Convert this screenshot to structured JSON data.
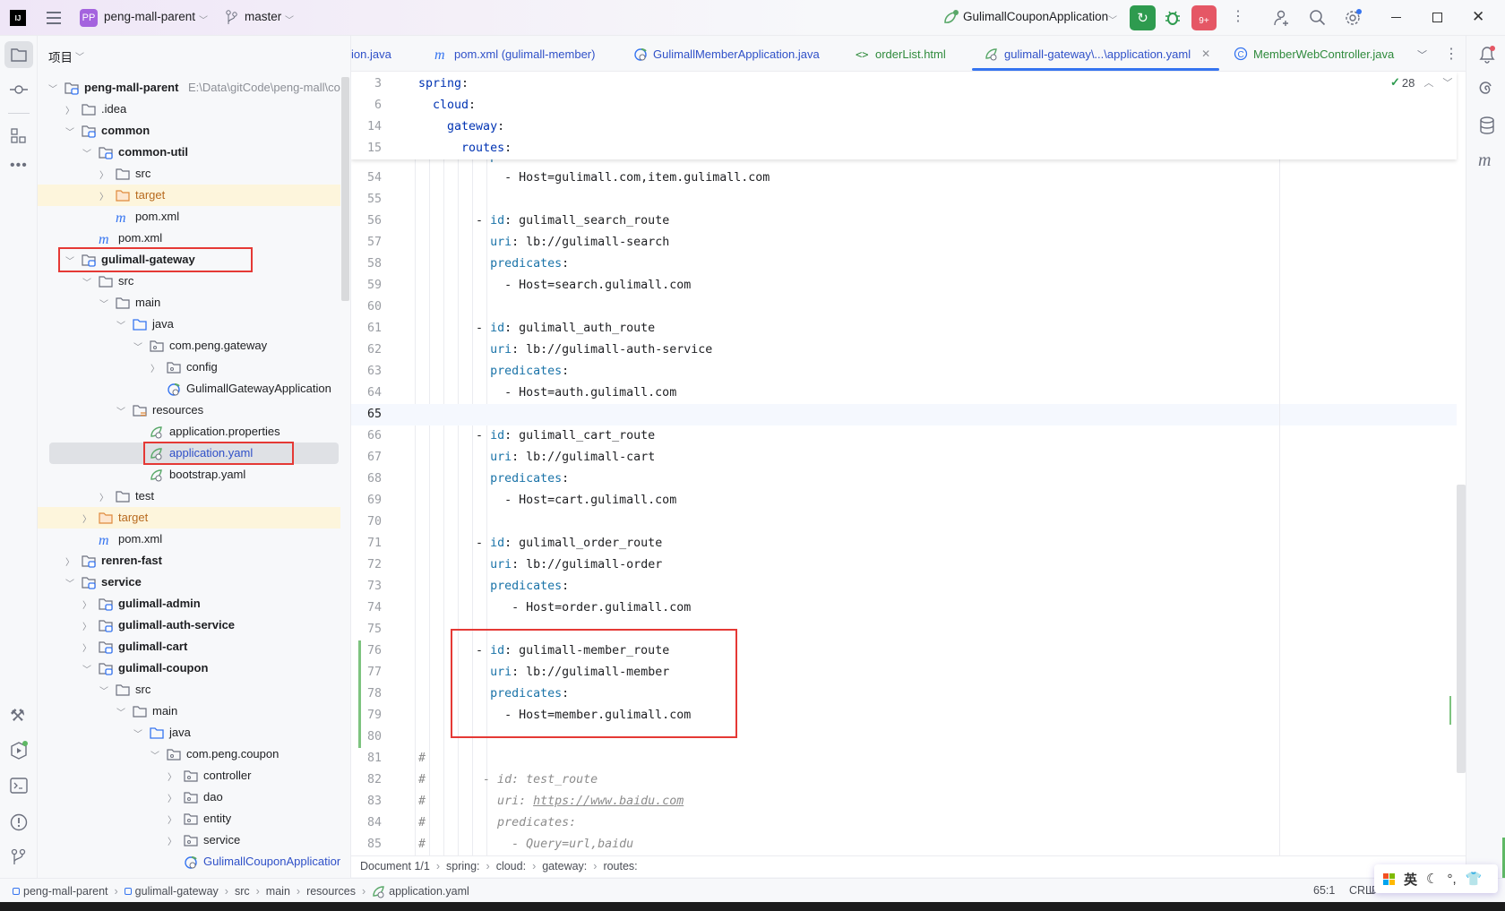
{
  "titlebar": {
    "project_badge": "PP",
    "project_name": "peng-mall-parent",
    "branch": "master",
    "run_config": "GulimallCouponApplication",
    "run_badge_count": "9+"
  },
  "project_panel": {
    "title": "项目",
    "root_path": "E:\\Data\\gitCode\\peng-mall\\cod",
    "tree": [
      {
        "label": "peng-mall-parent",
        "level": 0,
        "icon": "module",
        "expanded": true,
        "bold": true
      },
      {
        "label": ".idea",
        "level": 1,
        "icon": "folder",
        "expanded": false
      },
      {
        "label": "common",
        "level": 1,
        "icon": "module",
        "expanded": true,
        "bold": true
      },
      {
        "label": "common-util",
        "level": 2,
        "icon": "module",
        "expanded": true,
        "bold": true
      },
      {
        "label": "src",
        "level": 3,
        "icon": "folder",
        "expanded": false
      },
      {
        "label": "target",
        "level": 3,
        "icon": "excluded",
        "expanded": false,
        "highlight": true
      },
      {
        "label": "pom.xml",
        "level": 3,
        "icon": "maven"
      },
      {
        "label": "pom.xml",
        "level": 2,
        "icon": "maven"
      },
      {
        "label": "gulimall-gateway",
        "level": 1,
        "icon": "module",
        "expanded": true,
        "bold": true,
        "boxed": true
      },
      {
        "label": "src",
        "level": 2,
        "icon": "folder",
        "expanded": true
      },
      {
        "label": "main",
        "level": 3,
        "icon": "folder",
        "expanded": true
      },
      {
        "label": "java",
        "level": 4,
        "icon": "source",
        "expanded": true
      },
      {
        "label": "com.peng.gateway",
        "level": 5,
        "icon": "package",
        "expanded": true
      },
      {
        "label": "config",
        "level": 6,
        "icon": "package",
        "expanded": false
      },
      {
        "label": "GulimallGatewayApplication",
        "level": 6,
        "icon": "spring-app"
      },
      {
        "label": "resources",
        "level": 4,
        "icon": "resources",
        "expanded": true
      },
      {
        "label": "application.properties",
        "level": 5,
        "icon": "spring"
      },
      {
        "label": "application.yaml",
        "level": 5,
        "icon": "spring",
        "selected": true,
        "boxed": true
      },
      {
        "label": "bootstrap.yaml",
        "level": 5,
        "icon": "spring"
      },
      {
        "label": "test",
        "level": 3,
        "icon": "folder",
        "expanded": false
      },
      {
        "label": "target",
        "level": 2,
        "icon": "excluded",
        "expanded": false,
        "highlight": true
      },
      {
        "label": "pom.xml",
        "level": 2,
        "icon": "maven"
      },
      {
        "label": "renren-fast",
        "level": 1,
        "icon": "module",
        "expanded": false,
        "bold": true
      },
      {
        "label": "service",
        "level": 1,
        "icon": "module",
        "expanded": true,
        "bold": true
      },
      {
        "label": "gulimall-admin",
        "level": 2,
        "icon": "module",
        "expanded": false,
        "bold": true
      },
      {
        "label": "gulimall-auth-service",
        "level": 2,
        "icon": "module",
        "expanded": false,
        "bold": true
      },
      {
        "label": "gulimall-cart",
        "level": 2,
        "icon": "module",
        "expanded": false,
        "bold": true
      },
      {
        "label": "gulimall-coupon",
        "level": 2,
        "icon": "module",
        "expanded": true,
        "bold": true
      },
      {
        "label": "src",
        "level": 3,
        "icon": "folder",
        "expanded": true
      },
      {
        "label": "main",
        "level": 4,
        "icon": "folder",
        "expanded": true
      },
      {
        "label": "java",
        "level": 5,
        "icon": "source",
        "expanded": true
      },
      {
        "label": "com.peng.coupon",
        "level": 6,
        "icon": "package",
        "expanded": true
      },
      {
        "label": "controller",
        "level": 7,
        "icon": "package",
        "expanded": false
      },
      {
        "label": "dao",
        "level": 7,
        "icon": "package",
        "expanded": false
      },
      {
        "label": "entity",
        "level": 7,
        "icon": "package",
        "expanded": false
      },
      {
        "label": "service",
        "level": 7,
        "icon": "package",
        "expanded": false
      },
      {
        "label": "GulimallCouponApplication",
        "level": 7,
        "icon": "spring-app",
        "running": true
      }
    ]
  },
  "tabs": [
    {
      "label": "ion.java",
      "icon": "none",
      "color": "#2f50c8"
    },
    {
      "label": "pom.xml (gulimall-member)",
      "icon": "maven",
      "color": "#2f50c8"
    },
    {
      "label": "GulimallMemberApplication.java",
      "icon": "spring-app",
      "color": "#2f50c8"
    },
    {
      "label": "orderList.html",
      "icon": "html",
      "color": "#2f8a3c"
    },
    {
      "label": "gulimall-gateway\\...\\application.yaml",
      "icon": "spring",
      "color": "#2f50c8",
      "active": true
    },
    {
      "label": "MemberWebController.java",
      "icon": "class",
      "color": "#2f8a3c"
    }
  ],
  "editor": {
    "inspection_count": "28",
    "current_line": 65,
    "sticky_lines": [
      {
        "n": "3",
        "text": "spring:"
      },
      {
        "n": "6",
        "text": "  cloud:"
      },
      {
        "n": "14",
        "text": "    gateway:"
      },
      {
        "n": "15",
        "text": "      routes:"
      }
    ],
    "lines": [
      {
        "n": "54",
        "text": "            - Host=gulimall.com,item.gulimall.com"
      },
      {
        "n": "55",
        "text": ""
      },
      {
        "n": "56",
        "text": "        - id: gulimall_search_route"
      },
      {
        "n": "57",
        "text": "          uri: lb://gulimall-search"
      },
      {
        "n": "58",
        "text": "          predicates:"
      },
      {
        "n": "59",
        "text": "            - Host=search.gulimall.com"
      },
      {
        "n": "60",
        "text": ""
      },
      {
        "n": "61",
        "text": "        - id: gulimall_auth_route"
      },
      {
        "n": "62",
        "text": "          uri: lb://gulimall-auth-service"
      },
      {
        "n": "63",
        "text": "          predicates:"
      },
      {
        "n": "64",
        "text": "            - Host=auth.gulimall.com"
      },
      {
        "n": "65",
        "text": ""
      },
      {
        "n": "66",
        "text": "        - id: gulimall_cart_route"
      },
      {
        "n": "67",
        "text": "          uri: lb://gulimall-cart"
      },
      {
        "n": "68",
        "text": "          predicates:"
      },
      {
        "n": "69",
        "text": "            - Host=cart.gulimall.com"
      },
      {
        "n": "70",
        "text": ""
      },
      {
        "n": "71",
        "text": "        - id: gulimall_order_route"
      },
      {
        "n": "72",
        "text": "          uri: lb://gulimall-order"
      },
      {
        "n": "73",
        "text": "          predicates:"
      },
      {
        "n": "74",
        "text": "             - Host=order.gulimall.com"
      },
      {
        "n": "75",
        "text": ""
      },
      {
        "n": "76",
        "text": "        - id: gulimall-member_route",
        "changed": true
      },
      {
        "n": "77",
        "text": "          uri: lb://gulimall-member",
        "changed": true
      },
      {
        "n": "78",
        "text": "          predicates:",
        "changed": true
      },
      {
        "n": "79",
        "text": "            - Host=member.gulimall.com",
        "changed": true
      },
      {
        "n": "80",
        "text": "",
        "changed": true
      },
      {
        "n": "81",
        "text": "#"
      },
      {
        "n": "82",
        "text": "#        - id: test_route"
      },
      {
        "n": "83",
        "text": "#          uri: https://www.baidu.com"
      },
      {
        "n": "84",
        "text": "#          predicates:"
      },
      {
        "n": "85",
        "text": "#            - Query=url,baidu"
      }
    ]
  },
  "editor_breadcrumb": [
    "Document 1/1",
    "spring:",
    "cloud:",
    "gateway:",
    "routes:"
  ],
  "status": {
    "path": [
      "peng-mall-parent",
      "gulimall-gateway",
      "src",
      "main",
      "resources",
      "application.yaml"
    ],
    "position": "65:1",
    "line_ending": "CRLF",
    "encoding_cut": "U",
    "ime_label": "英"
  },
  "colors": {
    "accent": "#3574f0",
    "run_green": "#2e9b4f",
    "badge_red": "#e55765",
    "annotation_red": "#e53935",
    "changed_green": "#7dc37f"
  }
}
